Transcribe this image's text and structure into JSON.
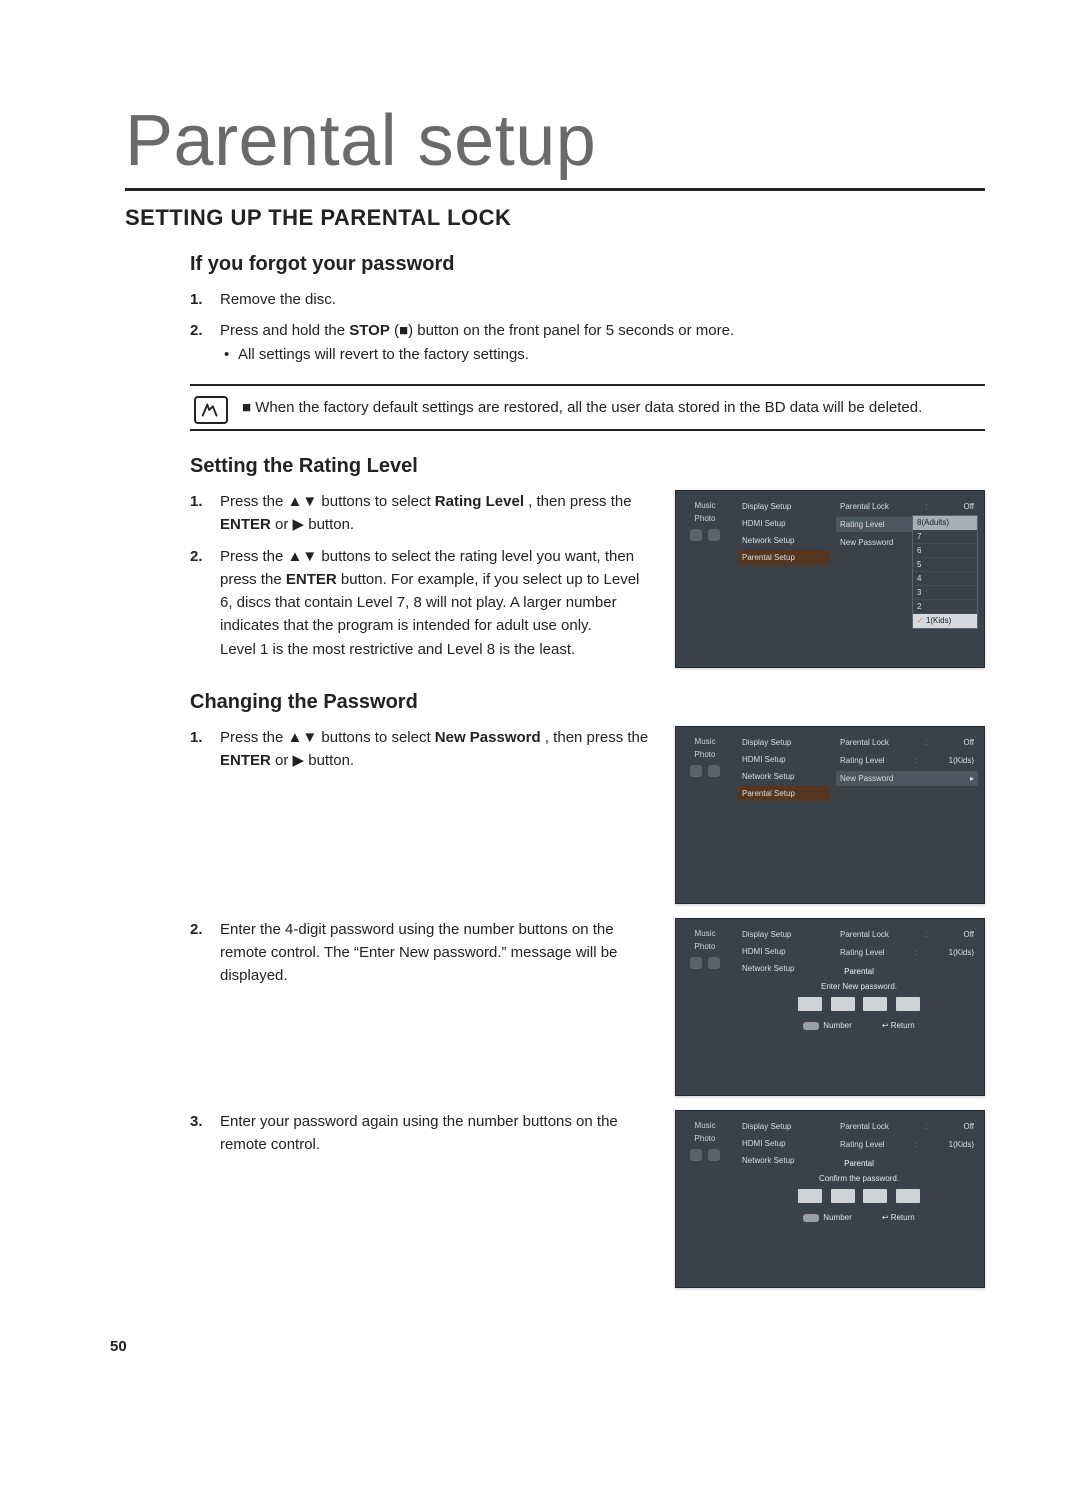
{
  "page_number": "50",
  "page_title": "Parental setup",
  "section_title": "SETTING UP THE PARENTAL LOCK",
  "forgot": {
    "title": "If you forgot your password",
    "step1": "Remove the disc.",
    "step2_pre": "Press and hold the ",
    "step2_stop": "STOP",
    "step2_icon": " (■) ",
    "step2_post": "button on the front panel for 5 seconds or more.",
    "step2_bullet": "All settings will revert to the factory settings."
  },
  "note": {
    "text": "When the factory default settings are restored, all the user data stored in the BD data will be deleted."
  },
  "rating": {
    "title": "Setting the Rating Level",
    "step1_a": "Press the ▲▼ buttons to select ",
    "step1_b": "Rating Level",
    "step1_c": ", then press the ",
    "step1_d": "ENTER",
    "step1_e": " or ▶ button.",
    "step2_a": "Press the ▲▼ buttons to select the rating level you want, then press the ",
    "step2_b": "ENTER",
    "step2_c": " button. For example, if you select up to Level 6, discs that contain Level 7, 8 will not play. A larger number indicates that the program is intended for adult use only.",
    "step2_note": "Level 1 is the most restrictive and Level 8 is the least."
  },
  "changing": {
    "title": "Changing the Password",
    "step1_a": "Press the ▲▼ buttons to select ",
    "step1_b": "New Password",
    "step1_c": ", then press the ",
    "step1_d": "ENTER",
    "step1_e": " or ▶ button.",
    "step2": "Enter the 4-digit password using the number buttons on the remote control. The “Enter New password.” message will be displayed.",
    "step3": "Enter your password again using the number buttons on the remote control."
  },
  "osd": {
    "left_items": [
      "Music",
      "Photo"
    ],
    "mid_items": [
      "Display Setup",
      "HDMI Setup",
      "Network Setup",
      "Parental Setup"
    ],
    "right_parental_lock": {
      "label": "Parental Lock",
      "value": "Off"
    },
    "right_rating_level": {
      "label": "Rating Level",
      "value": "1(Kids)"
    },
    "right_new_password": {
      "label": "New Password",
      "value": ""
    },
    "rating_options": [
      "8(Adults)",
      "7",
      "6",
      "5",
      "4",
      "3",
      "2",
      "1(Kids)"
    ],
    "modal_title": "Parental",
    "enter_msg": "Enter New password.",
    "confirm_msg": "Confirm the password.",
    "key_number": "Number",
    "key_return": "Return"
  }
}
